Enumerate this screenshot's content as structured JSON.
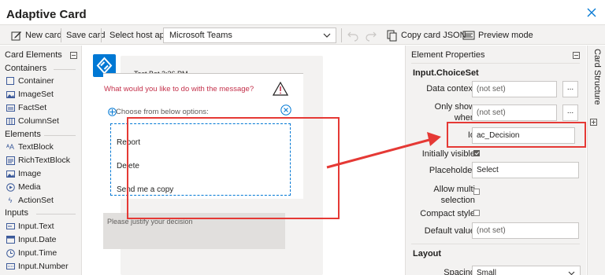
{
  "app": {
    "title": "Adaptive Card"
  },
  "toolbar": {
    "new_card": "New card",
    "save_card": "Save card",
    "host_label": "Select host app:",
    "host_value": "Microsoft Teams",
    "copy_json": "Copy card JSON",
    "preview_mode": "Preview mode"
  },
  "elements_panel": {
    "title": "Card Elements",
    "containers_heading": "Containers",
    "containers": [
      {
        "label": "Container",
        "icon": "container-icon"
      },
      {
        "label": "ImageSet",
        "icon": "imageset-icon"
      },
      {
        "label": "FactSet",
        "icon": "factset-icon"
      },
      {
        "label": "ColumnSet",
        "icon": "columnset-icon"
      }
    ],
    "elements_heading": "Elements",
    "elements": [
      {
        "label": "TextBlock",
        "icon": "textblock-icon"
      },
      {
        "label": "RichTextBlock",
        "icon": "richtextblock-icon"
      },
      {
        "label": "Image",
        "icon": "image-icon"
      },
      {
        "label": "Media",
        "icon": "media-icon"
      },
      {
        "label": "ActionSet",
        "icon": "actionset-icon"
      }
    ],
    "inputs_heading": "Inputs",
    "inputs": [
      {
        "label": "Input.Text",
        "icon": "input-text-icon"
      },
      {
        "label": "Input.Date",
        "icon": "input-date-icon"
      },
      {
        "label": "Input.Time",
        "icon": "input-time-icon"
      },
      {
        "label": "Input.Number",
        "icon": "input-number-icon"
      }
    ]
  },
  "canvas": {
    "sender": "Test Bot",
    "time": "2:36 PM",
    "question": "What would you like to do with the message?",
    "choice_label": "Choose from below options:",
    "options": [
      "Report",
      "Delete",
      "Send me a copy"
    ],
    "justify_placeholder": "Please justify your decision"
  },
  "properties": {
    "title": "Element Properties",
    "element_type": "Input.ChoiceSet",
    "data_context_label": "Data context",
    "data_context_value": "(not set)",
    "only_show_when_label": "Only show when",
    "only_show_when_value": "(not set)",
    "id_label": "Id",
    "id_value": "ac_Decision",
    "initially_visible_label": "Initially visible",
    "initially_visible": true,
    "placeholder_label": "Placeholder",
    "placeholder_value": "Select",
    "allow_multi_label": "Allow multi selection",
    "allow_multi": false,
    "compact_style_label": "Compact style",
    "compact_style": false,
    "default_value_label": "Default value",
    "default_value": "(not set)",
    "layout_heading": "Layout",
    "spacing_label": "Spacing",
    "spacing_value": "Small",
    "dots": "..."
  },
  "structure": {
    "title": "Card Structure"
  },
  "colors": {
    "highlight": "#e53935",
    "accent": "#0078d4",
    "question": "#c4314b"
  }
}
